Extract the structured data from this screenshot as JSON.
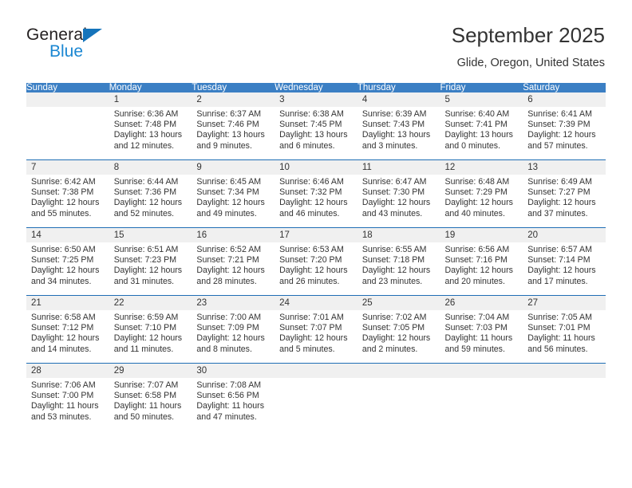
{
  "brand": {
    "word1": "General",
    "word2": "Blue",
    "triangle_color": "#1574bb",
    "blue_text_color": "#1b87d2"
  },
  "header": {
    "title": "September 2025",
    "location": "Glide, Oregon, United States"
  },
  "theme": {
    "header_row_bg": "#3b7fc4",
    "week_divider": "#1f6eb5",
    "daynum_band_bg": "#f0f0f0",
    "text": "#333333"
  },
  "calendar": {
    "weekday_headers": [
      "Sunday",
      "Monday",
      "Tuesday",
      "Wednesday",
      "Thursday",
      "Friday",
      "Saturday"
    ],
    "weeks": [
      [
        {
          "day": "",
          "sunrise": "",
          "sunset": "",
          "daylight_line1": "",
          "daylight_line2": ""
        },
        {
          "day": "1",
          "sunrise": "Sunrise: 6:36 AM",
          "sunset": "Sunset: 7:48 PM",
          "daylight_line1": "Daylight: 13 hours",
          "daylight_line2": "and 12 minutes."
        },
        {
          "day": "2",
          "sunrise": "Sunrise: 6:37 AM",
          "sunset": "Sunset: 7:46 PM",
          "daylight_line1": "Daylight: 13 hours",
          "daylight_line2": "and 9 minutes."
        },
        {
          "day": "3",
          "sunrise": "Sunrise: 6:38 AM",
          "sunset": "Sunset: 7:45 PM",
          "daylight_line1": "Daylight: 13 hours",
          "daylight_line2": "and 6 minutes."
        },
        {
          "day": "4",
          "sunrise": "Sunrise: 6:39 AM",
          "sunset": "Sunset: 7:43 PM",
          "daylight_line1": "Daylight: 13 hours",
          "daylight_line2": "and 3 minutes."
        },
        {
          "day": "5",
          "sunrise": "Sunrise: 6:40 AM",
          "sunset": "Sunset: 7:41 PM",
          "daylight_line1": "Daylight: 13 hours",
          "daylight_line2": "and 0 minutes."
        },
        {
          "day": "6",
          "sunrise": "Sunrise: 6:41 AM",
          "sunset": "Sunset: 7:39 PM",
          "daylight_line1": "Daylight: 12 hours",
          "daylight_line2": "and 57 minutes."
        }
      ],
      [
        {
          "day": "7",
          "sunrise": "Sunrise: 6:42 AM",
          "sunset": "Sunset: 7:38 PM",
          "daylight_line1": "Daylight: 12 hours",
          "daylight_line2": "and 55 minutes."
        },
        {
          "day": "8",
          "sunrise": "Sunrise: 6:44 AM",
          "sunset": "Sunset: 7:36 PM",
          "daylight_line1": "Daylight: 12 hours",
          "daylight_line2": "and 52 minutes."
        },
        {
          "day": "9",
          "sunrise": "Sunrise: 6:45 AM",
          "sunset": "Sunset: 7:34 PM",
          "daylight_line1": "Daylight: 12 hours",
          "daylight_line2": "and 49 minutes."
        },
        {
          "day": "10",
          "sunrise": "Sunrise: 6:46 AM",
          "sunset": "Sunset: 7:32 PM",
          "daylight_line1": "Daylight: 12 hours",
          "daylight_line2": "and 46 minutes."
        },
        {
          "day": "11",
          "sunrise": "Sunrise: 6:47 AM",
          "sunset": "Sunset: 7:30 PM",
          "daylight_line1": "Daylight: 12 hours",
          "daylight_line2": "and 43 minutes."
        },
        {
          "day": "12",
          "sunrise": "Sunrise: 6:48 AM",
          "sunset": "Sunset: 7:29 PM",
          "daylight_line1": "Daylight: 12 hours",
          "daylight_line2": "and 40 minutes."
        },
        {
          "day": "13",
          "sunrise": "Sunrise: 6:49 AM",
          "sunset": "Sunset: 7:27 PM",
          "daylight_line1": "Daylight: 12 hours",
          "daylight_line2": "and 37 minutes."
        }
      ],
      [
        {
          "day": "14",
          "sunrise": "Sunrise: 6:50 AM",
          "sunset": "Sunset: 7:25 PM",
          "daylight_line1": "Daylight: 12 hours",
          "daylight_line2": "and 34 minutes."
        },
        {
          "day": "15",
          "sunrise": "Sunrise: 6:51 AM",
          "sunset": "Sunset: 7:23 PM",
          "daylight_line1": "Daylight: 12 hours",
          "daylight_line2": "and 31 minutes."
        },
        {
          "day": "16",
          "sunrise": "Sunrise: 6:52 AM",
          "sunset": "Sunset: 7:21 PM",
          "daylight_line1": "Daylight: 12 hours",
          "daylight_line2": "and 28 minutes."
        },
        {
          "day": "17",
          "sunrise": "Sunrise: 6:53 AM",
          "sunset": "Sunset: 7:20 PM",
          "daylight_line1": "Daylight: 12 hours",
          "daylight_line2": "and 26 minutes."
        },
        {
          "day": "18",
          "sunrise": "Sunrise: 6:55 AM",
          "sunset": "Sunset: 7:18 PM",
          "daylight_line1": "Daylight: 12 hours",
          "daylight_line2": "and 23 minutes."
        },
        {
          "day": "19",
          "sunrise": "Sunrise: 6:56 AM",
          "sunset": "Sunset: 7:16 PM",
          "daylight_line1": "Daylight: 12 hours",
          "daylight_line2": "and 20 minutes."
        },
        {
          "day": "20",
          "sunrise": "Sunrise: 6:57 AM",
          "sunset": "Sunset: 7:14 PM",
          "daylight_line1": "Daylight: 12 hours",
          "daylight_line2": "and 17 minutes."
        }
      ],
      [
        {
          "day": "21",
          "sunrise": "Sunrise: 6:58 AM",
          "sunset": "Sunset: 7:12 PM",
          "daylight_line1": "Daylight: 12 hours",
          "daylight_line2": "and 14 minutes."
        },
        {
          "day": "22",
          "sunrise": "Sunrise: 6:59 AM",
          "sunset": "Sunset: 7:10 PM",
          "daylight_line1": "Daylight: 12 hours",
          "daylight_line2": "and 11 minutes."
        },
        {
          "day": "23",
          "sunrise": "Sunrise: 7:00 AM",
          "sunset": "Sunset: 7:09 PM",
          "daylight_line1": "Daylight: 12 hours",
          "daylight_line2": "and 8 minutes."
        },
        {
          "day": "24",
          "sunrise": "Sunrise: 7:01 AM",
          "sunset": "Sunset: 7:07 PM",
          "daylight_line1": "Daylight: 12 hours",
          "daylight_line2": "and 5 minutes."
        },
        {
          "day": "25",
          "sunrise": "Sunrise: 7:02 AM",
          "sunset": "Sunset: 7:05 PM",
          "daylight_line1": "Daylight: 12 hours",
          "daylight_line2": "and 2 minutes."
        },
        {
          "day": "26",
          "sunrise": "Sunrise: 7:04 AM",
          "sunset": "Sunset: 7:03 PM",
          "daylight_line1": "Daylight: 11 hours",
          "daylight_line2": "and 59 minutes."
        },
        {
          "day": "27",
          "sunrise": "Sunrise: 7:05 AM",
          "sunset": "Sunset: 7:01 PM",
          "daylight_line1": "Daylight: 11 hours",
          "daylight_line2": "and 56 minutes."
        }
      ],
      [
        {
          "day": "28",
          "sunrise": "Sunrise: 7:06 AM",
          "sunset": "Sunset: 7:00 PM",
          "daylight_line1": "Daylight: 11 hours",
          "daylight_line2": "and 53 minutes."
        },
        {
          "day": "29",
          "sunrise": "Sunrise: 7:07 AM",
          "sunset": "Sunset: 6:58 PM",
          "daylight_line1": "Daylight: 11 hours",
          "daylight_line2": "and 50 minutes."
        },
        {
          "day": "30",
          "sunrise": "Sunrise: 7:08 AM",
          "sunset": "Sunset: 6:56 PM",
          "daylight_line1": "Daylight: 11 hours",
          "daylight_line2": "and 47 minutes."
        },
        {
          "day": "",
          "sunrise": "",
          "sunset": "",
          "daylight_line1": "",
          "daylight_line2": ""
        },
        {
          "day": "",
          "sunrise": "",
          "sunset": "",
          "daylight_line1": "",
          "daylight_line2": ""
        },
        {
          "day": "",
          "sunrise": "",
          "sunset": "",
          "daylight_line1": "",
          "daylight_line2": ""
        },
        {
          "day": "",
          "sunrise": "",
          "sunset": "",
          "daylight_line1": "",
          "daylight_line2": ""
        }
      ]
    ]
  }
}
